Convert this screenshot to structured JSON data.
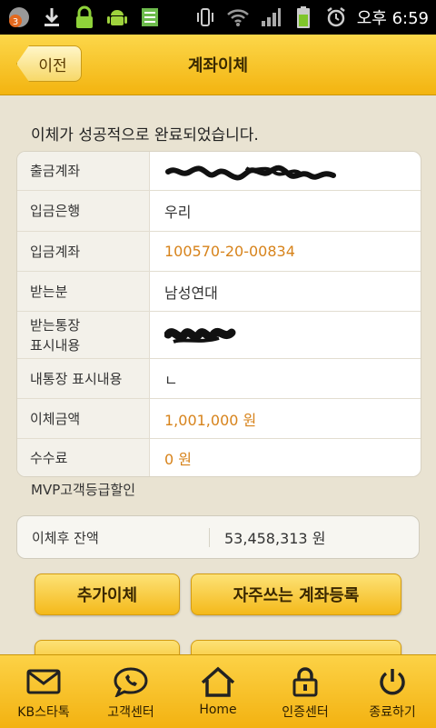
{
  "status_bar": {
    "notification_badge": "3",
    "time": "오후 6:59",
    "icons": [
      "notification-icon",
      "download-icon",
      "lock-icon",
      "android-icon",
      "sim-icon",
      "vibrate-icon",
      "wifi-icon",
      "signal-icon",
      "battery-icon",
      "alarm-icon"
    ]
  },
  "header": {
    "back_label": "이전",
    "title": "계좌이체"
  },
  "main": {
    "success_message": "이체가 성공적으로 완료되었습니다.",
    "rows": [
      {
        "label": "출금계좌",
        "value": "",
        "redacted": true
      },
      {
        "label": "입금은행",
        "value": "우리"
      },
      {
        "label": "입금계좌",
        "value": "100570-20-00834"
      },
      {
        "label": "받는분",
        "value": "남성연대"
      },
      {
        "label": "받는통장\n표시내용",
        "value": "",
        "redacted": true
      },
      {
        "label": "내통장 표시내용",
        "value": "ㄴ"
      },
      {
        "label": "이체금액",
        "value": "1,001,000 원"
      },
      {
        "label": "수수료",
        "value": "0 원"
      }
    ],
    "mvp_label": "MVP고객등급할인",
    "balance": {
      "label": "이체후 잔액",
      "value": "53,458,313 원"
    },
    "buttons": {
      "add_transfer": "추가이체",
      "register_frequent": "자주쓰는 계좌등록"
    }
  },
  "tabbar": {
    "items": [
      {
        "label": "KB스타톡",
        "icon": "mail-icon"
      },
      {
        "label": "고객센터",
        "icon": "chat-icon"
      },
      {
        "label": "Home",
        "icon": "home-icon"
      },
      {
        "label": "인증센터",
        "icon": "lock-icon"
      },
      {
        "label": "종료하기",
        "icon": "power-icon"
      }
    ]
  },
  "colors": {
    "accent": "#f3b410",
    "value_orange": "#d7831b"
  }
}
